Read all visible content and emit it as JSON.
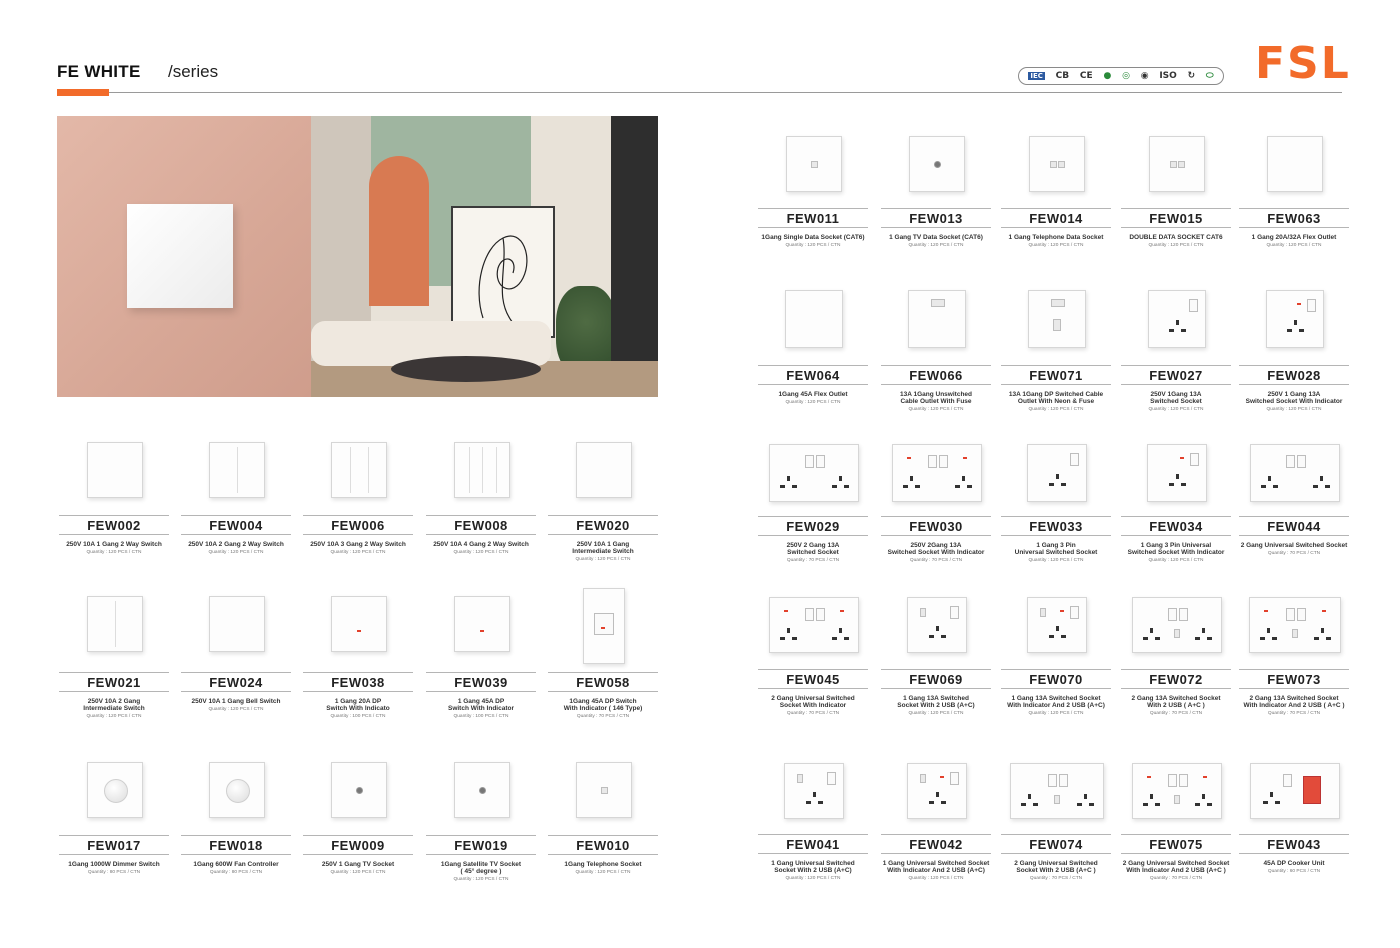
{
  "header": {
    "title": "FE WHITE",
    "subtitle": "/series",
    "brand": "FSL",
    "accent_color": "#f26b2a",
    "certifications": [
      "IEC",
      "CB",
      "CE",
      "cert-mark-green",
      "cert-mark-blue",
      "CCC",
      "ISO",
      "cert-mark-2",
      "cert-mark-3"
    ]
  },
  "photo": {
    "description_icon": "interior-room-photo"
  },
  "products": [
    {
      "code": "FEW002",
      "desc": "250V 10A 1 Gang 2 Way Switch",
      "qty": "Quantity :    120 PCS / CTN"
    },
    {
      "code": "FEW004",
      "desc": "250V 10A 2 Gang 2 Way Switch",
      "qty": "Quantity :    120 PCS / CTN"
    },
    {
      "code": "FEW006",
      "desc": "250V 10A 3 Gang 2 Way Switch",
      "qty": "Quantity :    120 PCS / CTN"
    },
    {
      "code": "FEW008",
      "desc": "250V 10A 4 Gang 2 Way Switch",
      "qty": "Quantity :    120 PCS / CTN"
    },
    {
      "code": "FEW020",
      "desc": "250V 10A 1 Gang\nIntermediate Switch",
      "qty": "Quantity :    120 PCS / CTN"
    },
    {
      "code": "FEW021",
      "desc": "250V 10A 2 Gang\nIntermediate Switch",
      "qty": "Quantity :    120 PCS / CTN"
    },
    {
      "code": "FEW024",
      "desc": "250V 10A 1 Gang Bell Switch",
      "qty": "Quantity :    120 PCS / CTN"
    },
    {
      "code": "FEW038",
      "desc": "1 Gang 20A DP\nSwitch With Indicato",
      "qty": "Quantity :    100 PCS / CTN"
    },
    {
      "code": "FEW039",
      "desc": "1 Gang 45A DP\nSwitch With Indicator",
      "qty": "Quantity :    100 PCS / CTN"
    },
    {
      "code": "FEW058",
      "desc": "1Gang 45A  DP Switch\nWith Indicator ( 146 Type)",
      "qty": "Quantity :    70 PCS / CTN"
    },
    {
      "code": "FEW017",
      "desc": "1Gang 1000W Dimmer Switch",
      "qty": "Quantity :    80 PCS / CTN"
    },
    {
      "code": "FEW018",
      "desc": "1Gang 600W Fan Controller",
      "qty": "Quantity :    80 PCS / CTN"
    },
    {
      "code": "FEW009",
      "desc": "250V 1 Gang TV Socket",
      "qty": "Quantity :    120 PCS / CTN"
    },
    {
      "code": "FEW019",
      "desc": "1Gang Satellite TV Socket\n( 45° degree )",
      "qty": "Quantity :    120 PCS / CTN"
    },
    {
      "code": "FEW010",
      "desc": "1Gang Telephone Socket",
      "qty": "Quantity :    120 PCS / CTN"
    },
    {
      "code": "FEW011",
      "desc": "1Gang Single Data Socket (CAT6)",
      "qty": "Quantity :    120 PCS / CTN"
    },
    {
      "code": "FEW013",
      "desc": "1 Gang TV Data Socket (CAT6)",
      "qty": "Quantity :    120 PCS / CTN"
    },
    {
      "code": "FEW014",
      "desc": "1 Gang Telephone Data Socket",
      "qty": "Quantity :    120 PCS / CTN"
    },
    {
      "code": "FEW015",
      "desc": "DOUBLE DATA SOCKET CAT6",
      "qty": "Quantity :    120 PCS / CTN"
    },
    {
      "code": "FEW063",
      "desc": "1 Gang 20A/32A Flex Outlet",
      "qty": "Quantity :    120 PCS / CTN"
    },
    {
      "code": "FEW064",
      "desc": "1Gang 45A Flex Outlet",
      "qty": "Quantity :    120 PCS / CTN"
    },
    {
      "code": "FEW066",
      "desc": "13A 1Gang Unswitched\nCable Outlet With Fuse",
      "qty": "Quantity :    120 PCS / CTN"
    },
    {
      "code": "FEW071",
      "desc": "13A 1Gang DP Switched Cable\nOutlet With Neon & Fuse",
      "qty": "Quantity :    120 PCS / CTN"
    },
    {
      "code": "FEW027",
      "desc": "250V 1Gang 13A\nSwitched Socket",
      "qty": "Quantity :    120 PCS / CTN"
    },
    {
      "code": "FEW028",
      "desc": "250V 1 Gang 13A\nSwitched  Socket With Indicator",
      "qty": "Quantity :    120 PCS / CTN"
    },
    {
      "code": "FEW029",
      "desc": "250V 2 Gang 13A\nSwitched  Socket",
      "qty": "Quantity :    70 PCS / CTN"
    },
    {
      "code": "FEW030",
      "desc": "250V 2Gang 13A\nSwitched Socket With Indicator",
      "qty": "Quantity :    70 PCS / CTN"
    },
    {
      "code": "FEW033",
      "desc": "1 Gang  3 Pin\nUniversal Switched  Socket",
      "qty": "Quantity :    120 PCS / CTN"
    },
    {
      "code": "FEW034",
      "desc": "1 Gang 3 Pin Universal\nSwitched  Socket With Indicator",
      "qty": "Quantity :    120 PCS / CTN"
    },
    {
      "code": "FEW044",
      "desc": "2 Gang Universal Switched Socket",
      "qty": "Quantity :    70 PCS / CTN"
    },
    {
      "code": "FEW045",
      "desc": "2 Gang Universal Switched\nSocket With Indicator",
      "qty": "Quantity :    70 PCS / CTN"
    },
    {
      "code": "FEW069",
      "desc": "1 Gang 13A Switched\nSocket With  2 USB  (A+C)",
      "qty": "Quantity :    120 PCS / CTN"
    },
    {
      "code": "FEW070",
      "desc": "1 Gang 13A Switched Socket\nWith Indicator And  2 USB  (A+C)",
      "qty": "Quantity :    120 PCS / CTN"
    },
    {
      "code": "FEW072",
      "desc": "2 Gang 13A Switched Socket\nWith 2 USB  ( A+C )",
      "qty": "Quantity :    70 PCS / CTN"
    },
    {
      "code": "FEW073",
      "desc": "2 Gang 13A Switched Socket\nWith Indicator And 2 USB  ( A+C )",
      "qty": "Quantity :    70 PCS / CTN"
    },
    {
      "code": "FEW041",
      "desc": "1 Gang Universal Switched\nSocket  With 2 USB  (A+C)",
      "qty": "Quantity :    120 PCS / CTN"
    },
    {
      "code": "FEW042",
      "desc": "1 Gang Universal Switched Socket\nWith Indicator And 2 USB  (A+C)",
      "qty": "Quantity :    120 PCS / CTN"
    },
    {
      "code": "FEW074",
      "desc": "2 Gang Universal Switched\nSocket With  2 USB (A+C )",
      "qty": "Quantity :    70 PCS / CTN"
    },
    {
      "code": "FEW075",
      "desc": "2 Gang Universal Switched Socket\nWith Indicator And 2 USB (A+C )",
      "qty": "Quantity :    70 PCS / CTN"
    },
    {
      "code": "FEW043",
      "desc": "45A DP Cooker Unit",
      "qty": "Quantity :    60 PCS / CTN"
    }
  ]
}
